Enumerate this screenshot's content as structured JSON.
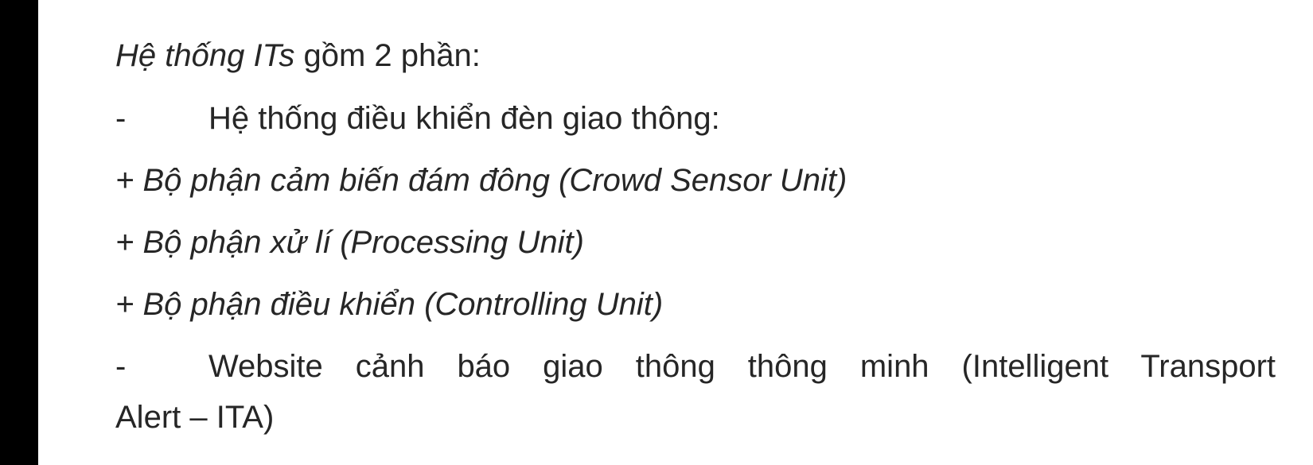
{
  "document": {
    "intro": {
      "italic_part": "Hệ thống ITs",
      "normal_part": " gồm 2 phần:"
    },
    "items": [
      {
        "marker": "-",
        "text": "Hệ thống điều khiển đèn giao thông:"
      },
      {
        "sub_items": [
          "+ Bộ phận cảm biến đám đông (Crowd Sensor Unit)",
          "+ Bộ phận xử lí (Processing Unit)",
          "+ Bộ phận điều khiển (Controlling Unit)"
        ]
      },
      {
        "marker": "-",
        "text_line1": "Website cảnh báo giao thông thông minh (Intelligent Transport",
        "text_line2": "Alert – ITA)"
      }
    ]
  }
}
